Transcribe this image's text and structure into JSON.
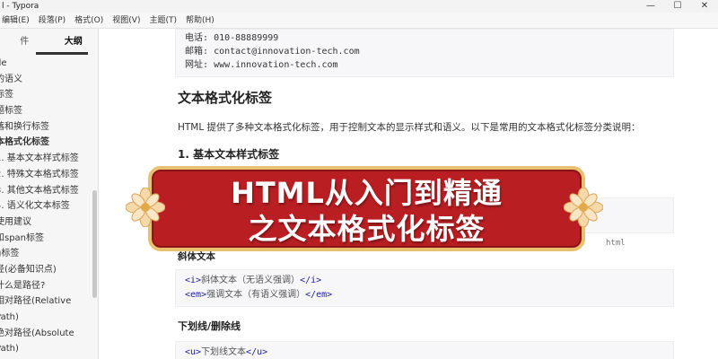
{
  "window": {
    "title": "l - Typora",
    "controls": [
      "—",
      "☐",
      "✕"
    ]
  },
  "menu": [
    "编辑(E)",
    "段落(P)",
    "格式(O)",
    "视图(V)",
    "主题(T)",
    "帮助(H)"
  ],
  "sidebar": {
    "tab_files": "件",
    "tab_outline": "大纲",
    "items": [
      {
        "label": "de"
      },
      {
        "label": "的语义"
      },
      {
        "label": "标签"
      },
      {
        "label": "题标签"
      },
      {
        "label": "落和换行标签"
      },
      {
        "label": "本格式化标签"
      },
      {
        "label": "1. 基本文本样式标签"
      },
      {
        "label": "2. 特殊文本格式标签"
      },
      {
        "label": "3. 其他文本格式标签"
      },
      {
        "label": "4. 语义化文本标签"
      },
      {
        "label": "使用建议"
      },
      {
        "label": "和span标签"
      },
      {
        "label": "g标签"
      },
      {
        "label": "径(必备知识点)"
      },
      {
        "label": "什么是路径?"
      },
      {
        "label": "相对路径(Relative"
      },
      {
        "label": "Path)"
      },
      {
        "label": "绝对路径(Absolute"
      },
      {
        "label": "Path)"
      }
    ]
  },
  "content": {
    "contact_lines": [
      {
        "label": "电话:",
        "value": "010-88889999"
      },
      {
        "label": "邮箱:",
        "value": "contact@innovation-tech.com"
      },
      {
        "label": "网址:",
        "value": "www.innovation-tech.com"
      }
    ],
    "heading": "文本格式化标签",
    "intro": "HTML 提供了多种文本格式化标签，用于控制文本的显示样式和语义。以下是常用的文本格式化标签分类说明：",
    "section1": "1. 基本文本样式标签",
    "code_lang": "html",
    "partial_heading": "斜体文本",
    "italic_code": [
      {
        "open": "<i>",
        "text": "斜体文本（无语义强调）",
        "close": "</i>"
      },
      {
        "open": "<em>",
        "text": "强调文本（有语义强调）",
        "close": "</em>"
      }
    ],
    "underline_heading": "下划线/删除线",
    "underline_code": [
      {
        "open": "<u>",
        "text": "下划线文本",
        "close": "</u>"
      }
    ]
  },
  "banner": {
    "line1": "HTML从入门到精通",
    "line2": "之文本格式化标签",
    "bg_color": "#b81e22",
    "border_color": "#e9c06f"
  }
}
